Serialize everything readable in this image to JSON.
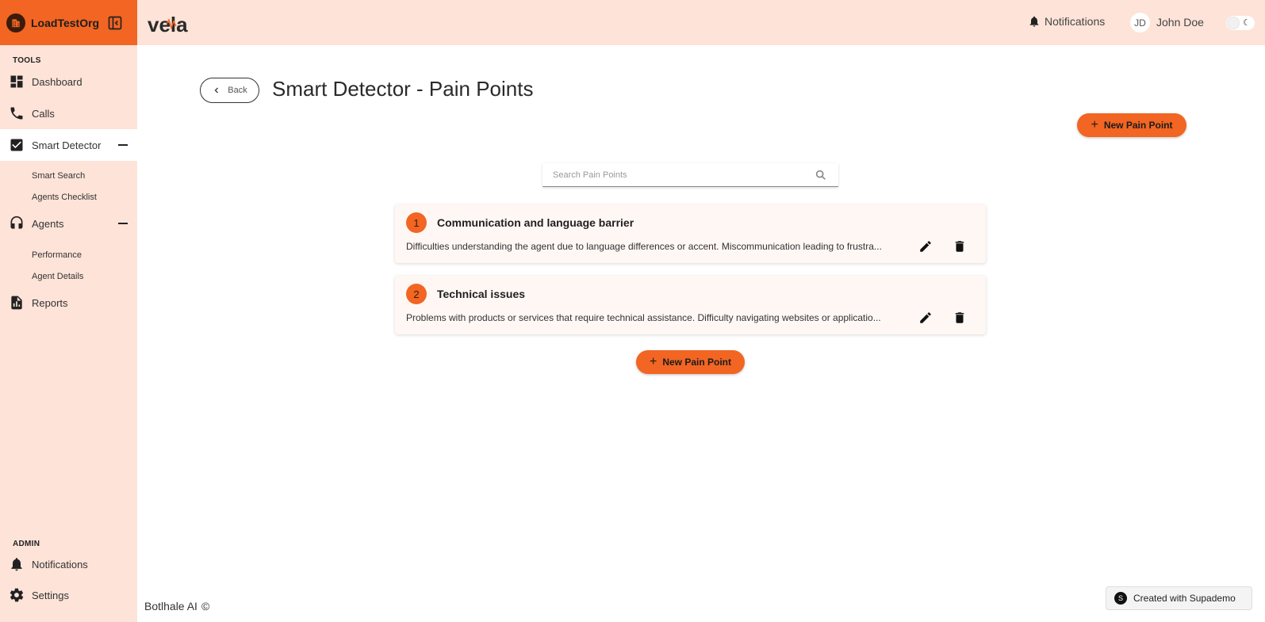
{
  "org": {
    "name": "LoadTestOrg"
  },
  "sidebar": {
    "tools_title": "TOOLS",
    "items": [
      {
        "label": "Dashboard",
        "icon": "dashboard-icon"
      },
      {
        "label": "Calls",
        "icon": "phone-icon"
      },
      {
        "label": "Smart Detector",
        "icon": "check-box-icon",
        "expanded": true,
        "active": true
      },
      {
        "label": "Agents",
        "icon": "headset-icon",
        "expanded": true
      },
      {
        "label": "Reports",
        "icon": "report-icon"
      }
    ],
    "smart_detector_sub": [
      "Smart Search",
      "Agents Checklist"
    ],
    "agents_sub": [
      "Performance",
      "Agent Details"
    ],
    "admin_title": "ADMIN",
    "admin_items": [
      {
        "label": "Notifications",
        "icon": "bell-icon"
      },
      {
        "label": "Settings",
        "icon": "gear-icon"
      }
    ]
  },
  "header": {
    "brand": "vela",
    "notifications_label": "Notifications",
    "user_initials": "JD",
    "user_name": "John Doe",
    "theme_toggle": "light"
  },
  "main": {
    "back_label": "Back",
    "title": "Smart Detector - Pain Points",
    "new_button_label": "New Pain Point",
    "search_placeholder": "Search Pain Points",
    "pain_points": [
      {
        "number": "1",
        "title": "Communication and language barrier",
        "description": "Difficulties understanding the agent due to language differences or accent. Miscommunication leading to frustra..."
      },
      {
        "number": "2",
        "title": "Technical issues",
        "description": "Problems with products or services that require technical assistance. Difficulty navigating websites or applicatio..."
      }
    ]
  },
  "footer": {
    "company": "Botlhale AI",
    "copyright_symbol": "©",
    "supademo_label": "Created with Supademo"
  },
  "colors": {
    "accent": "#f26522",
    "sidebar_bg": "#fde3d8",
    "card_bg": "#fff7f4"
  }
}
